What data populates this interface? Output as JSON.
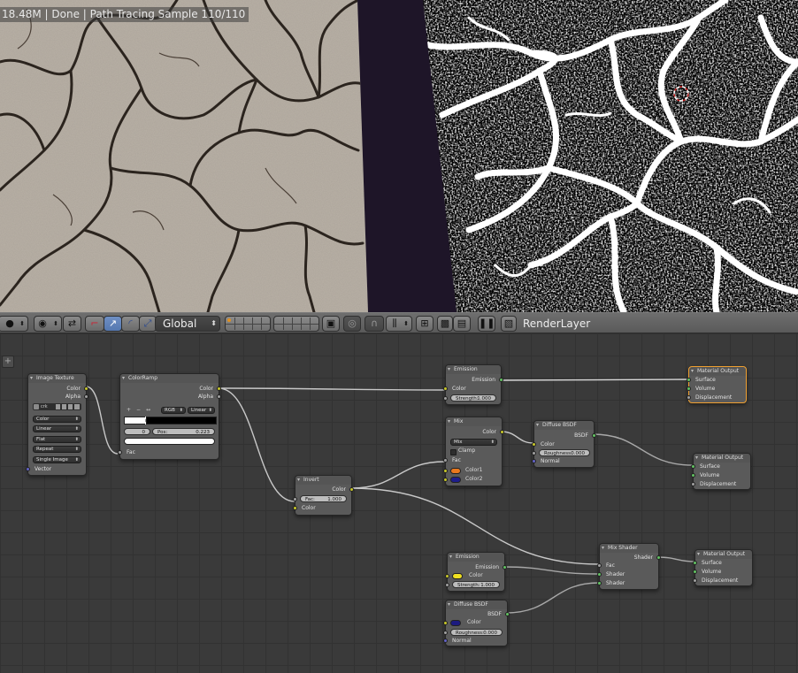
{
  "viewport": {
    "status": "18.48M | Done | Path Tracing Sample 110/110"
  },
  "toolbar": {
    "orientation": "Global",
    "render_layer": "RenderLayer",
    "colors": {
      "active_manip": "#5a7fb8",
      "bar": "#606060"
    }
  },
  "nodes": {
    "image_texture": {
      "title": "Image Texture",
      "outputs": [
        "Color",
        "Alpha"
      ],
      "image_name": "crk",
      "options": [
        "Color",
        "Linear",
        "Flat",
        "Repeat",
        "Single Image"
      ],
      "input": "Vector"
    },
    "color_ramp": {
      "title": "ColorRamp",
      "outputs": [
        "Color",
        "Alpha"
      ],
      "mode": "RGB",
      "interpolation": "Linear",
      "stop_index": "0",
      "pos_label": "Pos:",
      "pos_value": "0.223",
      "input": "Fac"
    },
    "invert": {
      "title": "Invert",
      "output": "Color",
      "fac_label": "Fac:",
      "fac_value": "1.000",
      "input": "Color"
    },
    "emission_top": {
      "title": "Emission",
      "output": "Emission",
      "input": "Color",
      "strength_label": "Strength:",
      "strength_value": "1.000"
    },
    "mix": {
      "title": "Mix",
      "output": "Color",
      "blend": "Mix",
      "clamp": "Clamp",
      "inputs": [
        "Fac",
        "Color1",
        "Color2"
      ],
      "color1": "#e8781e",
      "color2": "#1e1e8c"
    },
    "diffuse_mid": {
      "title": "Diffuse BSDF",
      "output": "BSDF",
      "input": "Color",
      "roughness_label": "Roughness:",
      "roughness_value": "0.000",
      "normal": "Normal"
    },
    "output_top": {
      "title": "Material Output",
      "inputs": [
        "Surface",
        "Volume",
        "Displacement"
      ]
    },
    "output_mid": {
      "title": "Material Output",
      "inputs": [
        "Surface",
        "Volume",
        "Displacement"
      ]
    },
    "output_bot": {
      "title": "Material Output",
      "inputs": [
        "Surface",
        "Volume",
        "Displacement"
      ]
    },
    "emission_bot": {
      "title": "Emission",
      "output": "Emission",
      "input": "Color",
      "color": "#f0e020",
      "strength_label": "Strength:",
      "strength_value": "1.000"
    },
    "diffuse_bot": {
      "title": "Diffuse BSDF",
      "output": "BSDF",
      "input": "Color",
      "color": "#1c1a80",
      "roughness_label": "Roughness:",
      "roughness_value": "0.000",
      "normal": "Normal"
    },
    "mix_shader": {
      "title": "Mix Shader",
      "output": "Shader",
      "inputs": [
        "Fac",
        "Shader",
        "Shader"
      ]
    }
  }
}
